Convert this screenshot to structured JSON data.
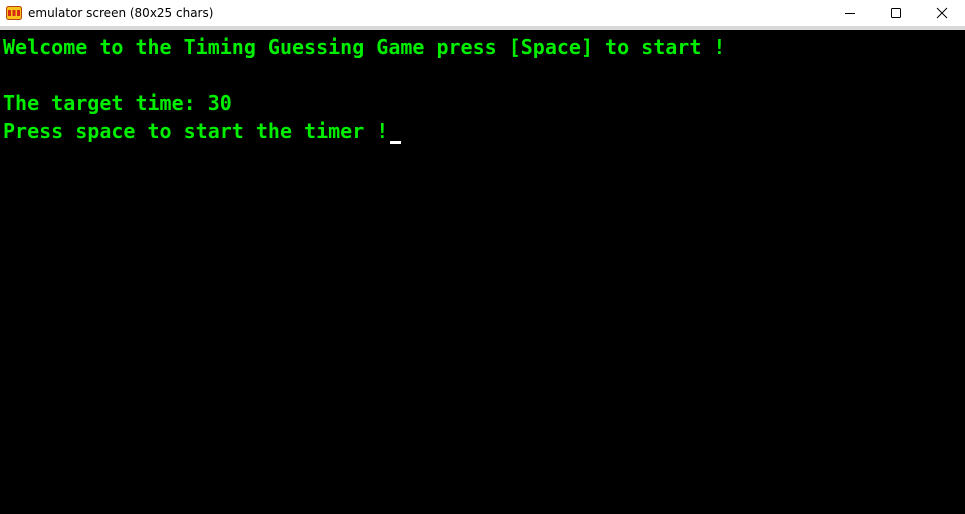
{
  "window": {
    "title": "emulator screen (80x25 chars)",
    "icon": "emu8086-app-icon",
    "controls": {
      "minimize_icon": "minimize-icon",
      "maximize_icon": "maximize-icon",
      "close_icon": "close-icon"
    }
  },
  "screen": {
    "text_color": "#00ee00",
    "background": "#000000",
    "lines": [
      "Welcome to the Timing Guessing Game press [Space] to start !",
      "",
      "The target time: 30",
      "Press space to start the timer !"
    ]
  }
}
